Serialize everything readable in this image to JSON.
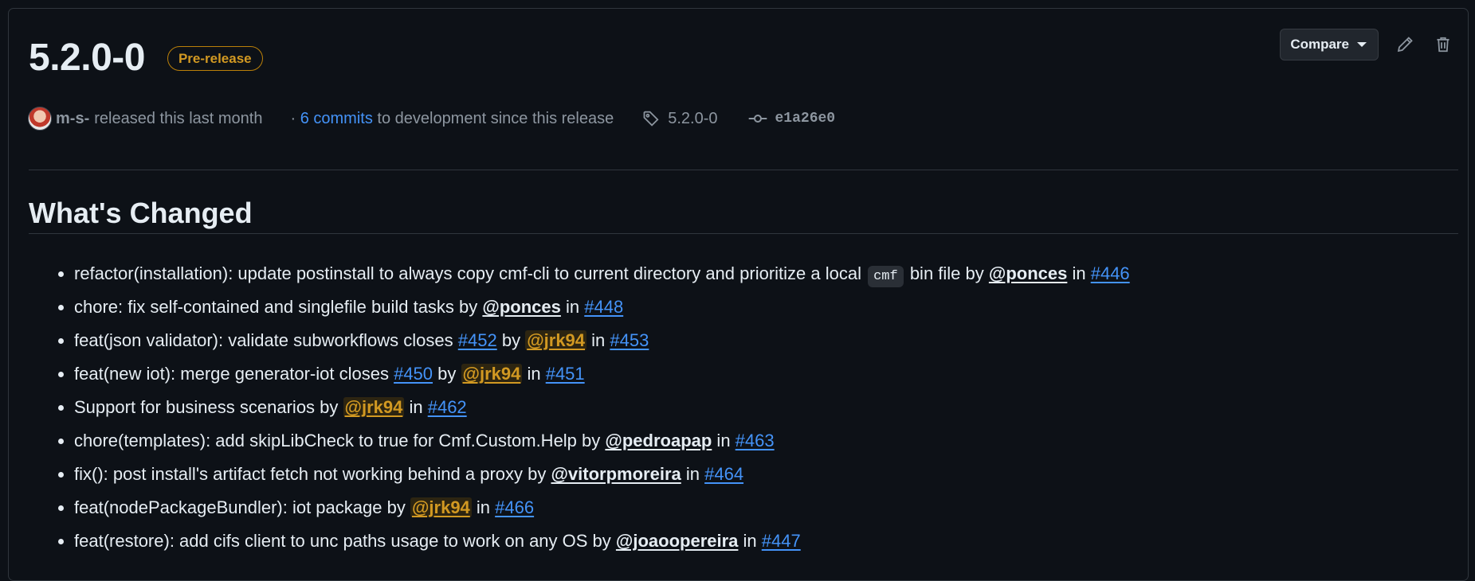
{
  "release": {
    "title": "5.2.0-0",
    "badge": "Pre-release"
  },
  "actions": {
    "compare_label": "Compare",
    "edit_icon": "pencil-icon",
    "delete_icon": "trash-icon"
  },
  "meta": {
    "author": "m-s-",
    "released_text": "released this last month",
    "commits_prefix": "·",
    "commits_link": "6 commits",
    "commits_suffix": "to development since this release",
    "tag": "5.2.0-0",
    "commit_sha": "e1a26e0"
  },
  "section": {
    "title": "What's Changed"
  },
  "changes": [
    {
      "text1": "refactor(installation): update postinstall to always copy cmf-cli to current directory and prioritize a local ",
      "code": "cmf",
      "text2": " bin file by ",
      "user": "@ponces",
      "in": " in ",
      "pr": "#446"
    },
    {
      "text": "chore: fix self-contained and singlefile build tasks by ",
      "user": "@ponces",
      "in": " in ",
      "pr": "#448"
    },
    {
      "text": "feat(json validator): validate subworkflows closes ",
      "ref": "#452",
      "by": " by ",
      "user": "@jrk94",
      "in": " in ",
      "pr": "#453"
    },
    {
      "text": "feat(new iot): merge generator-iot closes ",
      "ref": "#450",
      "by": " by ",
      "user": "@jrk94",
      "in": " in ",
      "pr": "#451"
    },
    {
      "text": "Support for business scenarios by ",
      "user": "@jrk94",
      "in": " in ",
      "pr": "#462"
    },
    {
      "text": "chore(templates): add skipLibCheck to true for Cmf.Custom.Help by ",
      "user": "@pedroapap",
      "in": " in ",
      "pr": "#463"
    },
    {
      "text": "fix(): post install's artifact fetch not working behind a proxy by ",
      "user": "@vitorpmoreira",
      "in": " in ",
      "pr": "#464"
    },
    {
      "text": "feat(nodePackageBundler): iot package by ",
      "user": "@jrk94",
      "in": " in ",
      "pr": "#466"
    },
    {
      "text": "feat(restore): add cifs client to unc paths usage to work on any OS by ",
      "user": "@joaoopereira",
      "in": " in ",
      "pr": "#447"
    }
  ],
  "colors": {
    "background": "#0d1117",
    "link": "#4493f8",
    "badge": "#d29922",
    "highlight_user": "#d29922"
  }
}
